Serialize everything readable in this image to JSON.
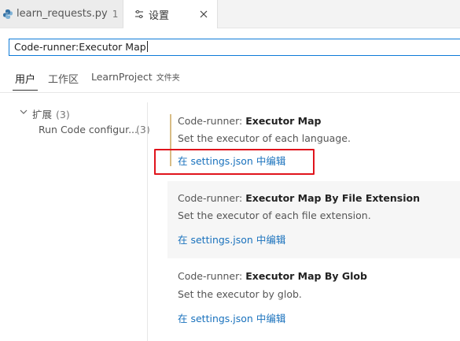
{
  "tabs": [
    {
      "title": "learn_requests.py",
      "badge": "1",
      "icon": "python-file-icon"
    },
    {
      "title": "设置",
      "icon": "settings-icon"
    }
  ],
  "search": {
    "value": "Code-runner:Executor Map"
  },
  "scopes": {
    "user": "用户",
    "workspace": "工作区",
    "folder": "LearnProject",
    "folder_sub": "文件夹"
  },
  "tree": {
    "extensions_label": "扩展",
    "extensions_count": "(3)",
    "run_code_label": "Run Code configur...",
    "run_code_count": "(3)"
  },
  "settings": [
    {
      "category": "Code-runner: ",
      "name": "Executor Map",
      "description": "Set the executor of each language.",
      "link": "在 settings.json 中编辑"
    },
    {
      "category": "Code-runner: ",
      "name": "Executor Map By File Extension",
      "description": "Set the executor of each file extension.",
      "link": "在 settings.json 中编辑"
    },
    {
      "category": "Code-runner: ",
      "name": "Executor Map By Glob",
      "description": "Set the executor by glob.",
      "link": "在 settings.json 中编辑"
    }
  ],
  "colors": {
    "accent_border": "#0e7bd8",
    "link": "#1a72bd",
    "modified_indicator": "#d8bd86",
    "annotation": "#e0141c"
  }
}
